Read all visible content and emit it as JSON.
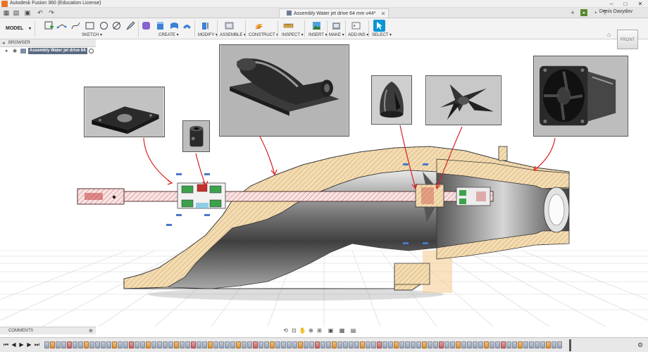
{
  "window": {
    "title": "Autodesk Fusion 360 (Education License)",
    "controls": [
      "–",
      "□",
      "✕"
    ]
  },
  "tabbar": {
    "document_tab": "Assembly Water jet drive 64 mm v44*",
    "user": "Denis Davydov"
  },
  "toolbar": {
    "workspace": "MODEL",
    "groups": [
      "SKETCH",
      "CREATE",
      "MODIFY",
      "ASSEMBLE",
      "CONSTRUCT",
      "INSPECT",
      "INSERT",
      "MAKE",
      "ADD-INS",
      "SELECT"
    ]
  },
  "browser": {
    "header": "BROWSER",
    "root_node": "Assembly Water jet drive 64 ..."
  },
  "viewcube": {
    "face": "FRONT"
  },
  "comments": {
    "label": "COMMENTS"
  },
  "colors": {
    "accent": "#0696d7",
    "hatch_fill": "#f1dbb4",
    "hatch_line": "#c69443",
    "section_red": "#d83030",
    "arrow_red": "#d82020"
  }
}
